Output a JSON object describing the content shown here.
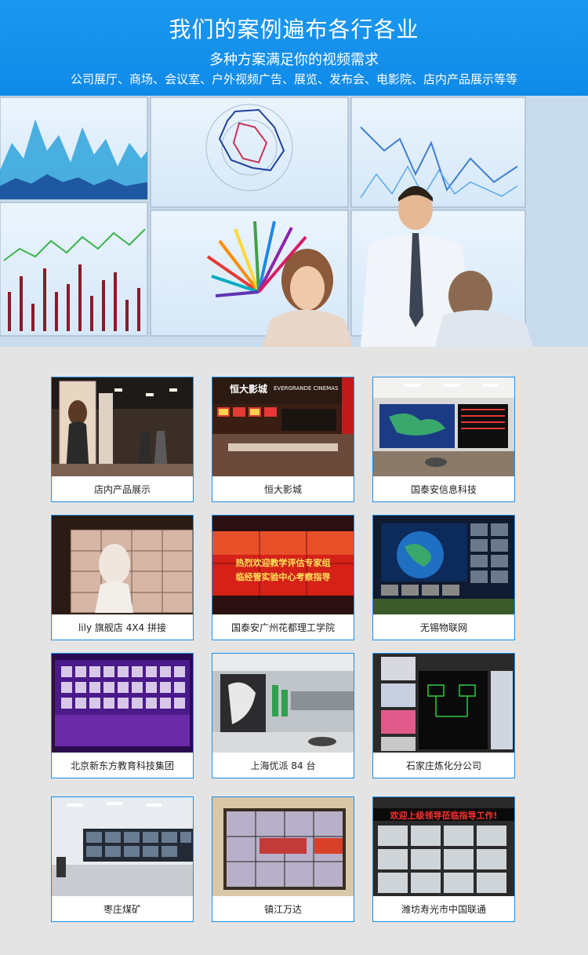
{
  "header": {
    "title": "我们的案例遍布各行各业",
    "subtitle": "多种方案满足你的视频需求",
    "scenarios": "公司展厅、商场、会议室、户外视频广告、展览、发布会、电影院、店内产品展示等等"
  },
  "cases": [
    {
      "label": "店内产品展示"
    },
    {
      "label": "恒大影城",
      "sign_cn": "恒大影城",
      "sign_en": "EVERGRANDE CINEMAS"
    },
    {
      "label": "国泰安信息科技"
    },
    {
      "label": "lily 旗舰店 4X4 拼接"
    },
    {
      "label": "国泰安广州花都理工学院",
      "screen_line1": "热烈欢迎教学评估专家组",
      "screen_line2": "临经管实验中心考察指导"
    },
    {
      "label": "无锡物联网"
    },
    {
      "label": "北京新东方教育科技集团"
    },
    {
      "label": "上海优派 84 台"
    },
    {
      "label": "石家庄炼化分公司"
    },
    {
      "label": "枣庄煤矿"
    },
    {
      "label": "镇江万达"
    },
    {
      "label": "潍坊寿光市中国联通",
      "screen_line1": "欢迎上级领导莅临指导工作!"
    }
  ]
}
